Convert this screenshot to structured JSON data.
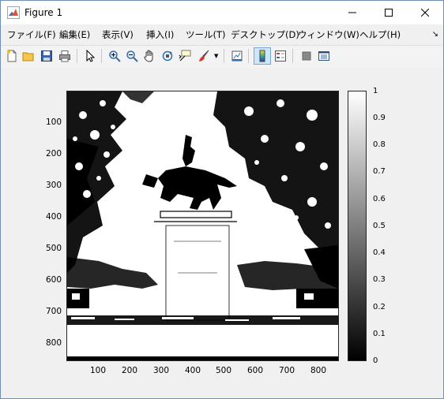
{
  "window": {
    "title": "Figure 1",
    "controls": {
      "minimize": "—",
      "maximize": "☐",
      "close": "✕"
    }
  },
  "menu": {
    "items": [
      "ファイル(F)",
      "編集(E)",
      "表示(V)",
      "挿入(I)",
      "ツール(T)",
      "デスクトップ(D)",
      "ウィンドウ(W)",
      "ヘルプ(H)"
    ],
    "overflow": "↘"
  },
  "toolbar": {
    "icons": [
      "new-figure-icon",
      "open-file-icon",
      "save-icon",
      "print-icon",
      "edit-plot-icon",
      "zoom-in-icon",
      "zoom-out-icon",
      "pan-icon",
      "rotate-3d-icon",
      "data-cursor-icon",
      "brush-icon",
      "link-plot-icon",
      "colorbar-icon",
      "legend-icon",
      "hide-plot-tools-icon",
      "show-plot-tools-icon"
    ]
  },
  "axes": {
    "y_ticks": [
      "100",
      "200",
      "300",
      "400",
      "500",
      "600",
      "700",
      "800"
    ],
    "x_ticks": [
      "100",
      "200",
      "300",
      "400",
      "500",
      "600",
      "700",
      "800"
    ]
  },
  "colorbar": {
    "ticks": [
      "1",
      "0.9",
      "0.8",
      "0.7",
      "0.6",
      "0.5",
      "0.4",
      "0.3",
      "0.2",
      "0.1",
      "0"
    ],
    "range": [
      0,
      1
    ],
    "colormap": "gray"
  },
  "image": {
    "description_icon": "binary-image-statue-trees"
  },
  "colors": {
    "accent": "#0078d7",
    "frame": "#6d8fb8"
  }
}
